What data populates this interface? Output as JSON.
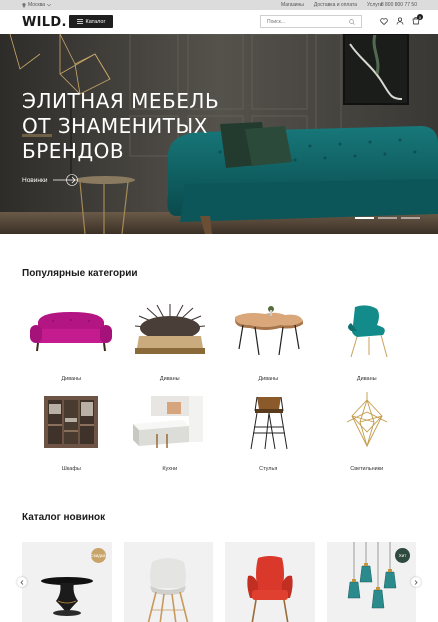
{
  "topbar": {
    "city": "Москва",
    "links": [
      "Магазины",
      "Доставка и оплата",
      "Услуги"
    ],
    "phone": "8 800 800 77 50"
  },
  "header": {
    "logo": "WILD.",
    "catalog_label": "Каталог",
    "search_placeholder": "Поиск...",
    "cart_count": "0"
  },
  "hero": {
    "title_line1": "ЭЛИТНАЯ МЕБЕЛЬ",
    "title_line2": "ОТ ЗНАМЕНИТЫХ",
    "title_line3": "БРЕНДОВ",
    "link_label": "Новинки",
    "slides_total": 3,
    "active_slide": 1
  },
  "popular": {
    "title": "Популярные категории",
    "items": [
      {
        "label": "Диваны",
        "icon": "pink-sofa"
      },
      {
        "label": "Диваны",
        "icon": "fur-sofa"
      },
      {
        "label": "Диваны",
        "icon": "wood-table"
      },
      {
        "label": "Диваны",
        "icon": "teal-chair"
      },
      {
        "label": "Шкафы",
        "icon": "wardrobe"
      },
      {
        "label": "Кухни",
        "icon": "kitchen"
      },
      {
        "label": "Стулья",
        "icon": "bar-stool"
      },
      {
        "label": "Светильники",
        "icon": "chandelier"
      }
    ]
  },
  "catalog_new": {
    "title": "Каталог новинок",
    "products": [
      {
        "badge": "Скидка",
        "badge_color": "#c9a46a",
        "icon": "black-table"
      },
      {
        "badge": "",
        "badge_color": "",
        "icon": "white-chair"
      },
      {
        "badge": "",
        "badge_color": "",
        "icon": "red-armchair"
      },
      {
        "badge": "Хит",
        "badge_color": "#2f4a3e",
        "icon": "pendant-lamps"
      }
    ]
  },
  "colors": {
    "accent_dark": "#1f1f1f",
    "sofa_teal": "#0f5f63",
    "hero_bg": "#3d3a36"
  }
}
